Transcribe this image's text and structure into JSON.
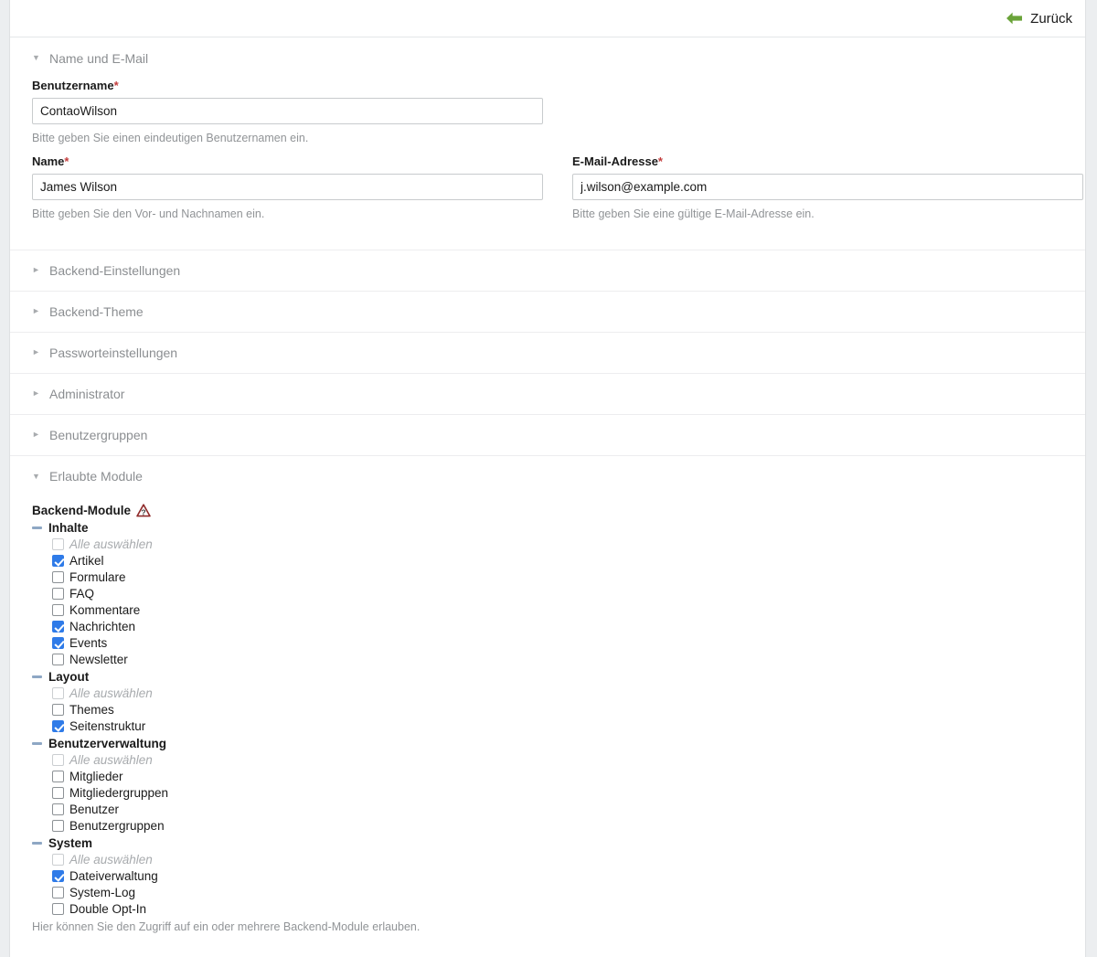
{
  "topbar": {
    "back_label": "Zurück",
    "back_icon": "arrow-left-icon",
    "arrow_color": "#6aa339"
  },
  "colors": {
    "required_star": "#c33c3c",
    "checkbox_checked": "#2f7be8",
    "legend_text": "#8b8e91",
    "hint_text": "#919497",
    "toggler": "#8ea7c4",
    "help_icon": "#8f2b2b"
  },
  "sections": [
    {
      "id": "name-und-email",
      "legend": "Name und E-Mail",
      "expanded": true,
      "marker": "▼"
    },
    {
      "id": "backend-einstellungen",
      "legend": "Backend-Einstellungen",
      "expanded": false,
      "marker": "►"
    },
    {
      "id": "backend-theme",
      "legend": "Backend-Theme",
      "expanded": false,
      "marker": "►"
    },
    {
      "id": "passworteinstellungen",
      "legend": "Passworteinstellungen",
      "expanded": false,
      "marker": "►"
    },
    {
      "id": "administrator",
      "legend": "Administrator",
      "expanded": false,
      "marker": "►"
    },
    {
      "id": "benutzergruppen",
      "legend": "Benutzergruppen",
      "expanded": false,
      "marker": "►"
    },
    {
      "id": "erlaubte-module",
      "legend": "Erlaubte Module",
      "expanded": true,
      "marker": "▼"
    }
  ],
  "fields": {
    "username": {
      "label": "Benutzername",
      "required_mark": "*",
      "value": "ContaoWilson",
      "hint": "Bitte geben Sie einen eindeutigen Benutzernamen ein."
    },
    "name": {
      "label": "Name",
      "required_mark": "*",
      "value": "James Wilson",
      "hint": "Bitte geben Sie den Vor- und Nachnamen ein."
    },
    "email": {
      "label": "E-Mail-Adresse",
      "required_mark": "*",
      "value": "j.wilson@example.com",
      "hint": "Bitte geben Sie eine gültige E-Mail-Adresse ein."
    }
  },
  "modules": {
    "label": "Backend-Module",
    "help_icon": "help-wizard-icon",
    "hint": "Hier können Sie den Zugriff auf ein oder mehrere Backend-Module erlauben.",
    "select_all_label": "Alle auswählen",
    "groups": [
      {
        "name": "Inhalte",
        "toggle_state": "expanded",
        "items": [
          {
            "label": "Alle auswählen",
            "checked": false,
            "disabled": true
          },
          {
            "label": "Artikel",
            "checked": true,
            "disabled": false
          },
          {
            "label": "Formulare",
            "checked": false,
            "disabled": false
          },
          {
            "label": "FAQ",
            "checked": false,
            "disabled": false
          },
          {
            "label": "Kommentare",
            "checked": false,
            "disabled": false
          },
          {
            "label": "Nachrichten",
            "checked": true,
            "disabled": false
          },
          {
            "label": "Events",
            "checked": true,
            "disabled": false
          },
          {
            "label": "Newsletter",
            "checked": false,
            "disabled": false
          }
        ]
      },
      {
        "name": "Layout",
        "toggle_state": "expanded",
        "items": [
          {
            "label": "Alle auswählen",
            "checked": false,
            "disabled": true
          },
          {
            "label": "Themes",
            "checked": false,
            "disabled": false
          },
          {
            "label": "Seitenstruktur",
            "checked": true,
            "disabled": false
          }
        ]
      },
      {
        "name": "Benutzerverwaltung",
        "toggle_state": "expanded",
        "items": [
          {
            "label": "Alle auswählen",
            "checked": false,
            "disabled": true
          },
          {
            "label": "Mitglieder",
            "checked": false,
            "disabled": false
          },
          {
            "label": "Mitgliedergruppen",
            "checked": false,
            "disabled": false
          },
          {
            "label": "Benutzer",
            "checked": false,
            "disabled": false
          },
          {
            "label": "Benutzergruppen",
            "checked": false,
            "disabled": false
          }
        ]
      },
      {
        "name": "System",
        "toggle_state": "expanded",
        "items": [
          {
            "label": "Alle auswählen",
            "checked": false,
            "disabled": true
          },
          {
            "label": "Dateiverwaltung",
            "checked": true,
            "disabled": false
          },
          {
            "label": "System-Log",
            "checked": false,
            "disabled": false
          },
          {
            "label": "Double Opt-In",
            "checked": false,
            "disabled": false
          }
        ]
      }
    ]
  }
}
